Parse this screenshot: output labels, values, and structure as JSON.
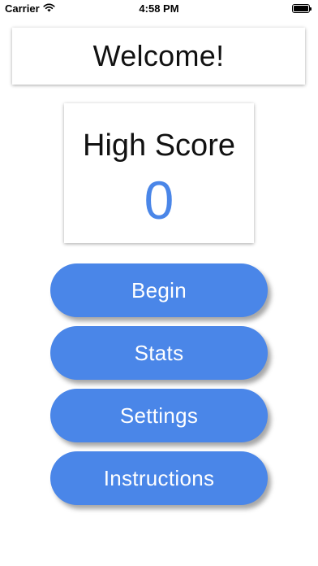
{
  "status_bar": {
    "carrier": "Carrier",
    "time": "4:58 PM",
    "wifi_icon": "wifi-icon",
    "battery_icon": "battery-icon"
  },
  "welcome": {
    "text": "Welcome!"
  },
  "high_score": {
    "title": "High Score",
    "value": "0"
  },
  "menu": {
    "begin_label": "Begin",
    "stats_label": "Stats",
    "settings_label": "Settings",
    "instructions_label": "Instructions"
  },
  "colors": {
    "accent": "#4a86e8",
    "background": "#ffffff",
    "text": "#111111"
  }
}
